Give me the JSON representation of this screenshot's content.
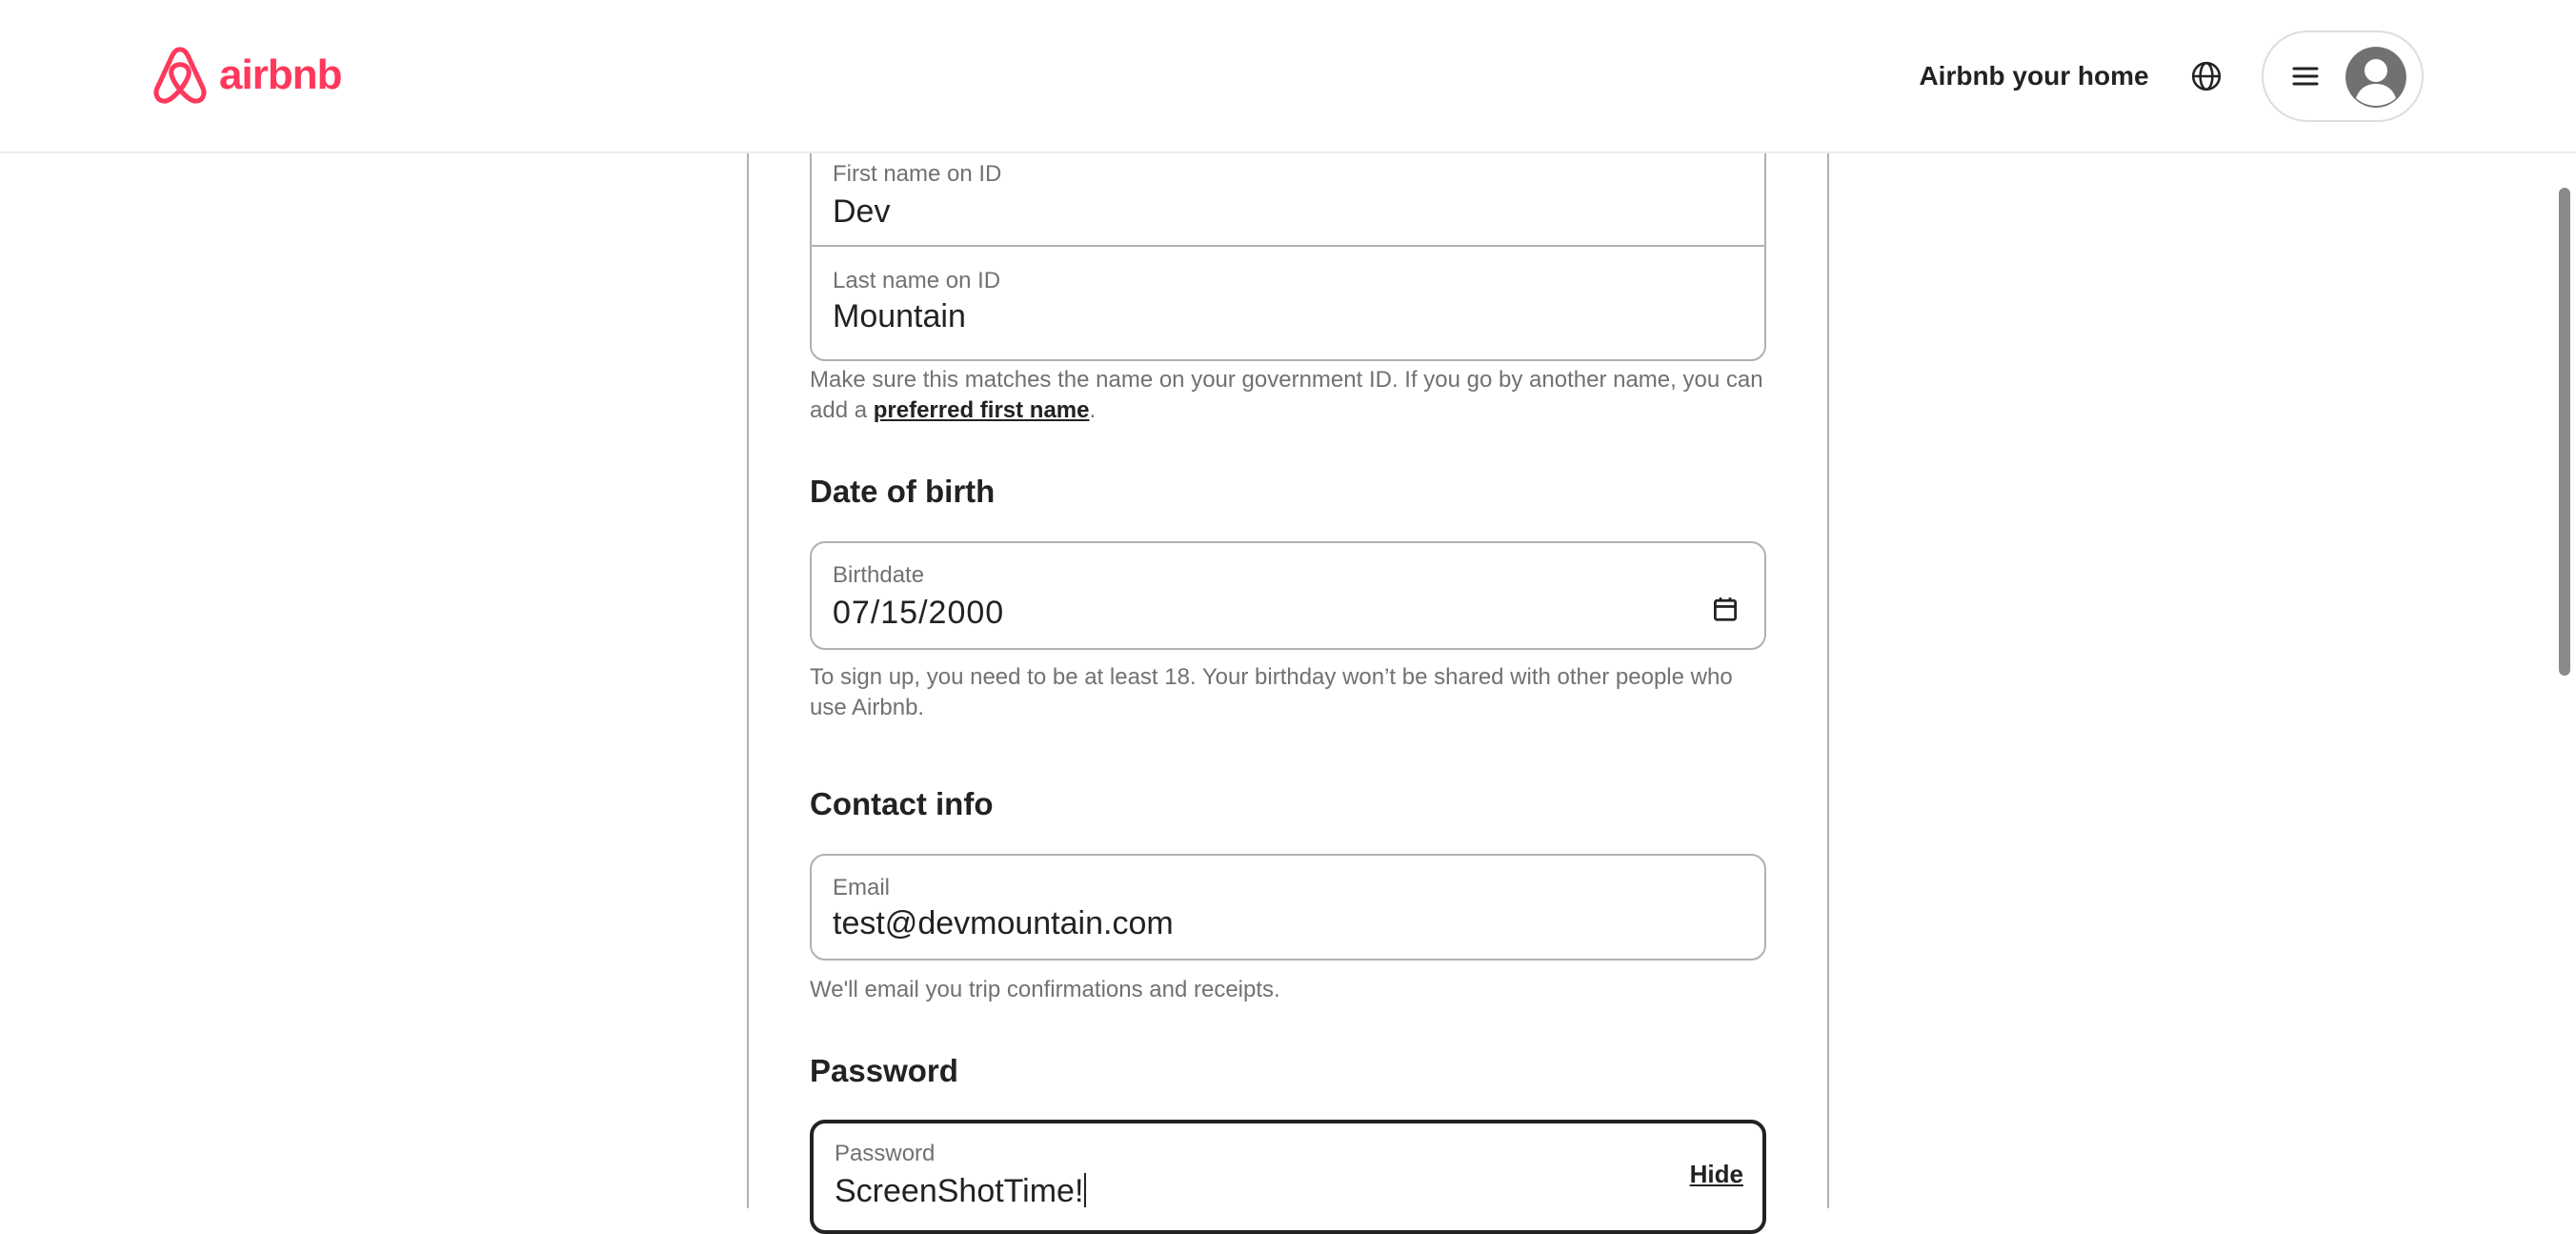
{
  "header": {
    "brand": "airbnb",
    "host_link": "Airbnb your home",
    "brand_color": "#ff385c",
    "icons": [
      "airbnb-logo-icon",
      "globe-icon",
      "hamburger-menu-icon",
      "user-avatar-icon"
    ]
  },
  "form": {
    "first_name": {
      "label": "First name on ID",
      "value": "Dev"
    },
    "last_name": {
      "label": "Last name on ID",
      "value": "Mountain"
    },
    "name_helper": {
      "before": "Make sure this matches the name on your government ID. If you go by another name, you can add a ",
      "link": "preferred first name",
      "after": "."
    },
    "dob": {
      "title": "Date of birth",
      "label": "Birthdate",
      "value": "07/15/2000",
      "helper": "To sign up, you need to be at least 18. Your birthday won’t be shared with other people who use Airbnb.",
      "icon": "calendar-icon"
    },
    "contact": {
      "title": "Contact info",
      "label": "Email",
      "value": "test@devmountain.com",
      "helper": "We'll email you trip confirmations and receipts."
    },
    "password": {
      "title": "Password",
      "label": "Password",
      "value": "ScreenShotTime!",
      "toggle_label": "Hide"
    }
  }
}
